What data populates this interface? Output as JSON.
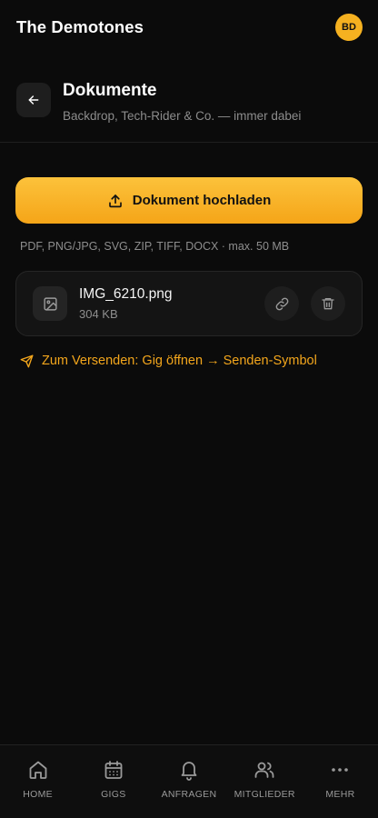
{
  "app": {
    "title": "The Demotones",
    "avatar_initials": "BD"
  },
  "header": {
    "title": "Dokumente",
    "subtitle": "Backdrop, Tech-Rider & Co. — immer dabei"
  },
  "upload": {
    "label": "Dokument hochladen",
    "formats": "PDF, PNG/JPG, SVG, ZIP, TIFF, DOCX · max. 50 MB"
  },
  "files": [
    {
      "name": "IMG_6210.png",
      "size": "304 KB",
      "icon": "image-icon"
    }
  ],
  "hint": "Zum Versenden: Gig öffnen → Senden-Symbol",
  "nav": {
    "items": [
      {
        "label": "HOME",
        "icon": "home-icon"
      },
      {
        "label": "GIGS",
        "icon": "calendar-icon"
      },
      {
        "label": "ANFRAGEN",
        "icon": "bell-icon"
      },
      {
        "label": "MITGLIEDER",
        "icon": "users-icon"
      },
      {
        "label": "MEHR",
        "icon": "more-icon"
      }
    ]
  },
  "colors": {
    "accent": "#f5b120",
    "background": "#0b0b0b",
    "card": "#141414"
  }
}
